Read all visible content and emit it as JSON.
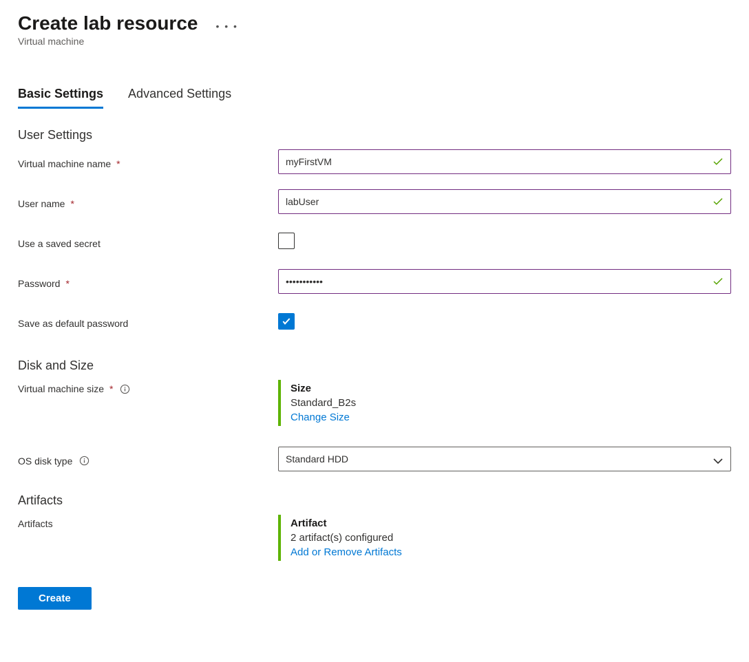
{
  "header": {
    "title": "Create lab resource",
    "subtitle": "Virtual machine"
  },
  "tabs": {
    "basic": "Basic Settings",
    "advanced": "Advanced Settings"
  },
  "section_user_settings": "User Settings",
  "fields": {
    "vm_name_label": "Virtual machine name",
    "vm_name_value": "myFirstVM",
    "user_name_label": "User name",
    "user_name_value": "labUser",
    "saved_secret_label": "Use a saved secret",
    "password_label": "Password",
    "password_value": "•••••••••••",
    "save_default_pw_label": "Save as default password"
  },
  "section_disk_size": "Disk and Size",
  "size": {
    "label": "Virtual machine size",
    "title": "Size",
    "value": "Standard_B2s",
    "link": "Change Size"
  },
  "os_disk": {
    "label": "OS disk type",
    "value": "Standard HDD"
  },
  "section_artifacts": "Artifacts",
  "artifacts": {
    "label": "Artifacts",
    "title": "Artifact",
    "value": "2 artifact(s) configured",
    "link": "Add or Remove Artifacts"
  },
  "footer": {
    "create": "Create"
  }
}
